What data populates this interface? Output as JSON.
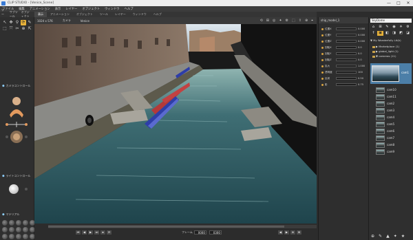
{
  "window": {
    "title": "CLIP STUDIO - [Venice_Scene]",
    "controls": [
      "—",
      "□",
      "✕"
    ]
  },
  "menu": [
    "ファイル",
    "編集",
    "アニメーション",
    "表示",
    "レイヤー",
    "オブジェクト",
    "ウィンドウ",
    "ヘルプ"
  ],
  "left_tabs": [
    "ツール",
    "サブツール",
    "オブジェクト"
  ],
  "view_tabs": [
    "表示",
    "アニメーション",
    "オブジェクト",
    "ツール",
    "レイヤー",
    "ウィンドウ",
    "ヘルプ"
  ],
  "view_tabs_active": 0,
  "viewport": {
    "header": [
      "1024 x 576",
      "カメラ",
      "Venice"
    ],
    "icons": [
      "⟲",
      "⊞",
      "◎",
      "✦",
      "⚙",
      "⬚",
      "⇧",
      "⊕",
      "⌖"
    ]
  },
  "tools": [
    "↖",
    "✥",
    "⚲",
    "⟳",
    "✎",
    "⬚",
    "⤧",
    "✂",
    "⊕",
    "⇱"
  ],
  "tool_selected": 3,
  "sections": {
    "camera": "カメラコントロール",
    "light": "ライトコントロール",
    "material": "マテリアル"
  },
  "playback": {
    "buttons": [
      "⏮",
      "◀",
      "▶",
      "⏭",
      "⏹",
      "⟳"
    ],
    "frame_label": "フレーム",
    "frame_current": "0000",
    "frame_total": "0300",
    "progress": 0.88,
    "right_buttons": [
      "◀",
      "▶",
      "⊕",
      "⊞"
    ]
  },
  "mid_panel": {
    "title": "ship_model_1",
    "rows": [
      {
        "label": "位置X",
        "value": "0.000"
      },
      {
        "label": "位置Y",
        "value": "0.000"
      },
      {
        "label": "位置Z",
        "value": "0.000"
      },
      {
        "label": "回転X",
        "value": "0.0"
      },
      {
        "label": "回転Y",
        "value": "0.0"
      },
      {
        "label": "回転Z",
        "value": "0.0"
      },
      {
        "label": "拡大",
        "value": "1.000"
      },
      {
        "label": "透明度",
        "value": "100"
      },
      {
        "label": "反射",
        "value": "0.50"
      },
      {
        "label": "影",
        "value": "0.75"
      }
    ]
  },
  "scene_panel": {
    "search": "SkyDome",
    "icon_row1": [
      "⌂",
      "⊞",
      "✎",
      "◉",
      "☀",
      "⚙"
    ],
    "icon_row2": [
      "↑",
      "▣",
      "◧",
      "◨",
      "◩",
      "◪"
    ],
    "icon_selected": 1,
    "tree": [
      "▼ My Wonderfully Lit(k)",
      "▶ Marketplace (1)",
      "▶ global_light (1)",
      "▼ cameras (11)"
    ],
    "cameras": [
      "cam1",
      "cam10",
      "cam11",
      "cam2",
      "cam3",
      "cam4",
      "cam5",
      "cam6",
      "cam7",
      "cam8",
      "cam9"
    ],
    "selected_camera": "cam1",
    "bottom_icons": [
      "⊕",
      "✎",
      "▲",
      "✦",
      "★"
    ]
  },
  "colors": {
    "accent": "#e8b23a",
    "selection": "#4c7fa8",
    "water": "#2d5a62",
    "sky": "#dfe8ef"
  }
}
